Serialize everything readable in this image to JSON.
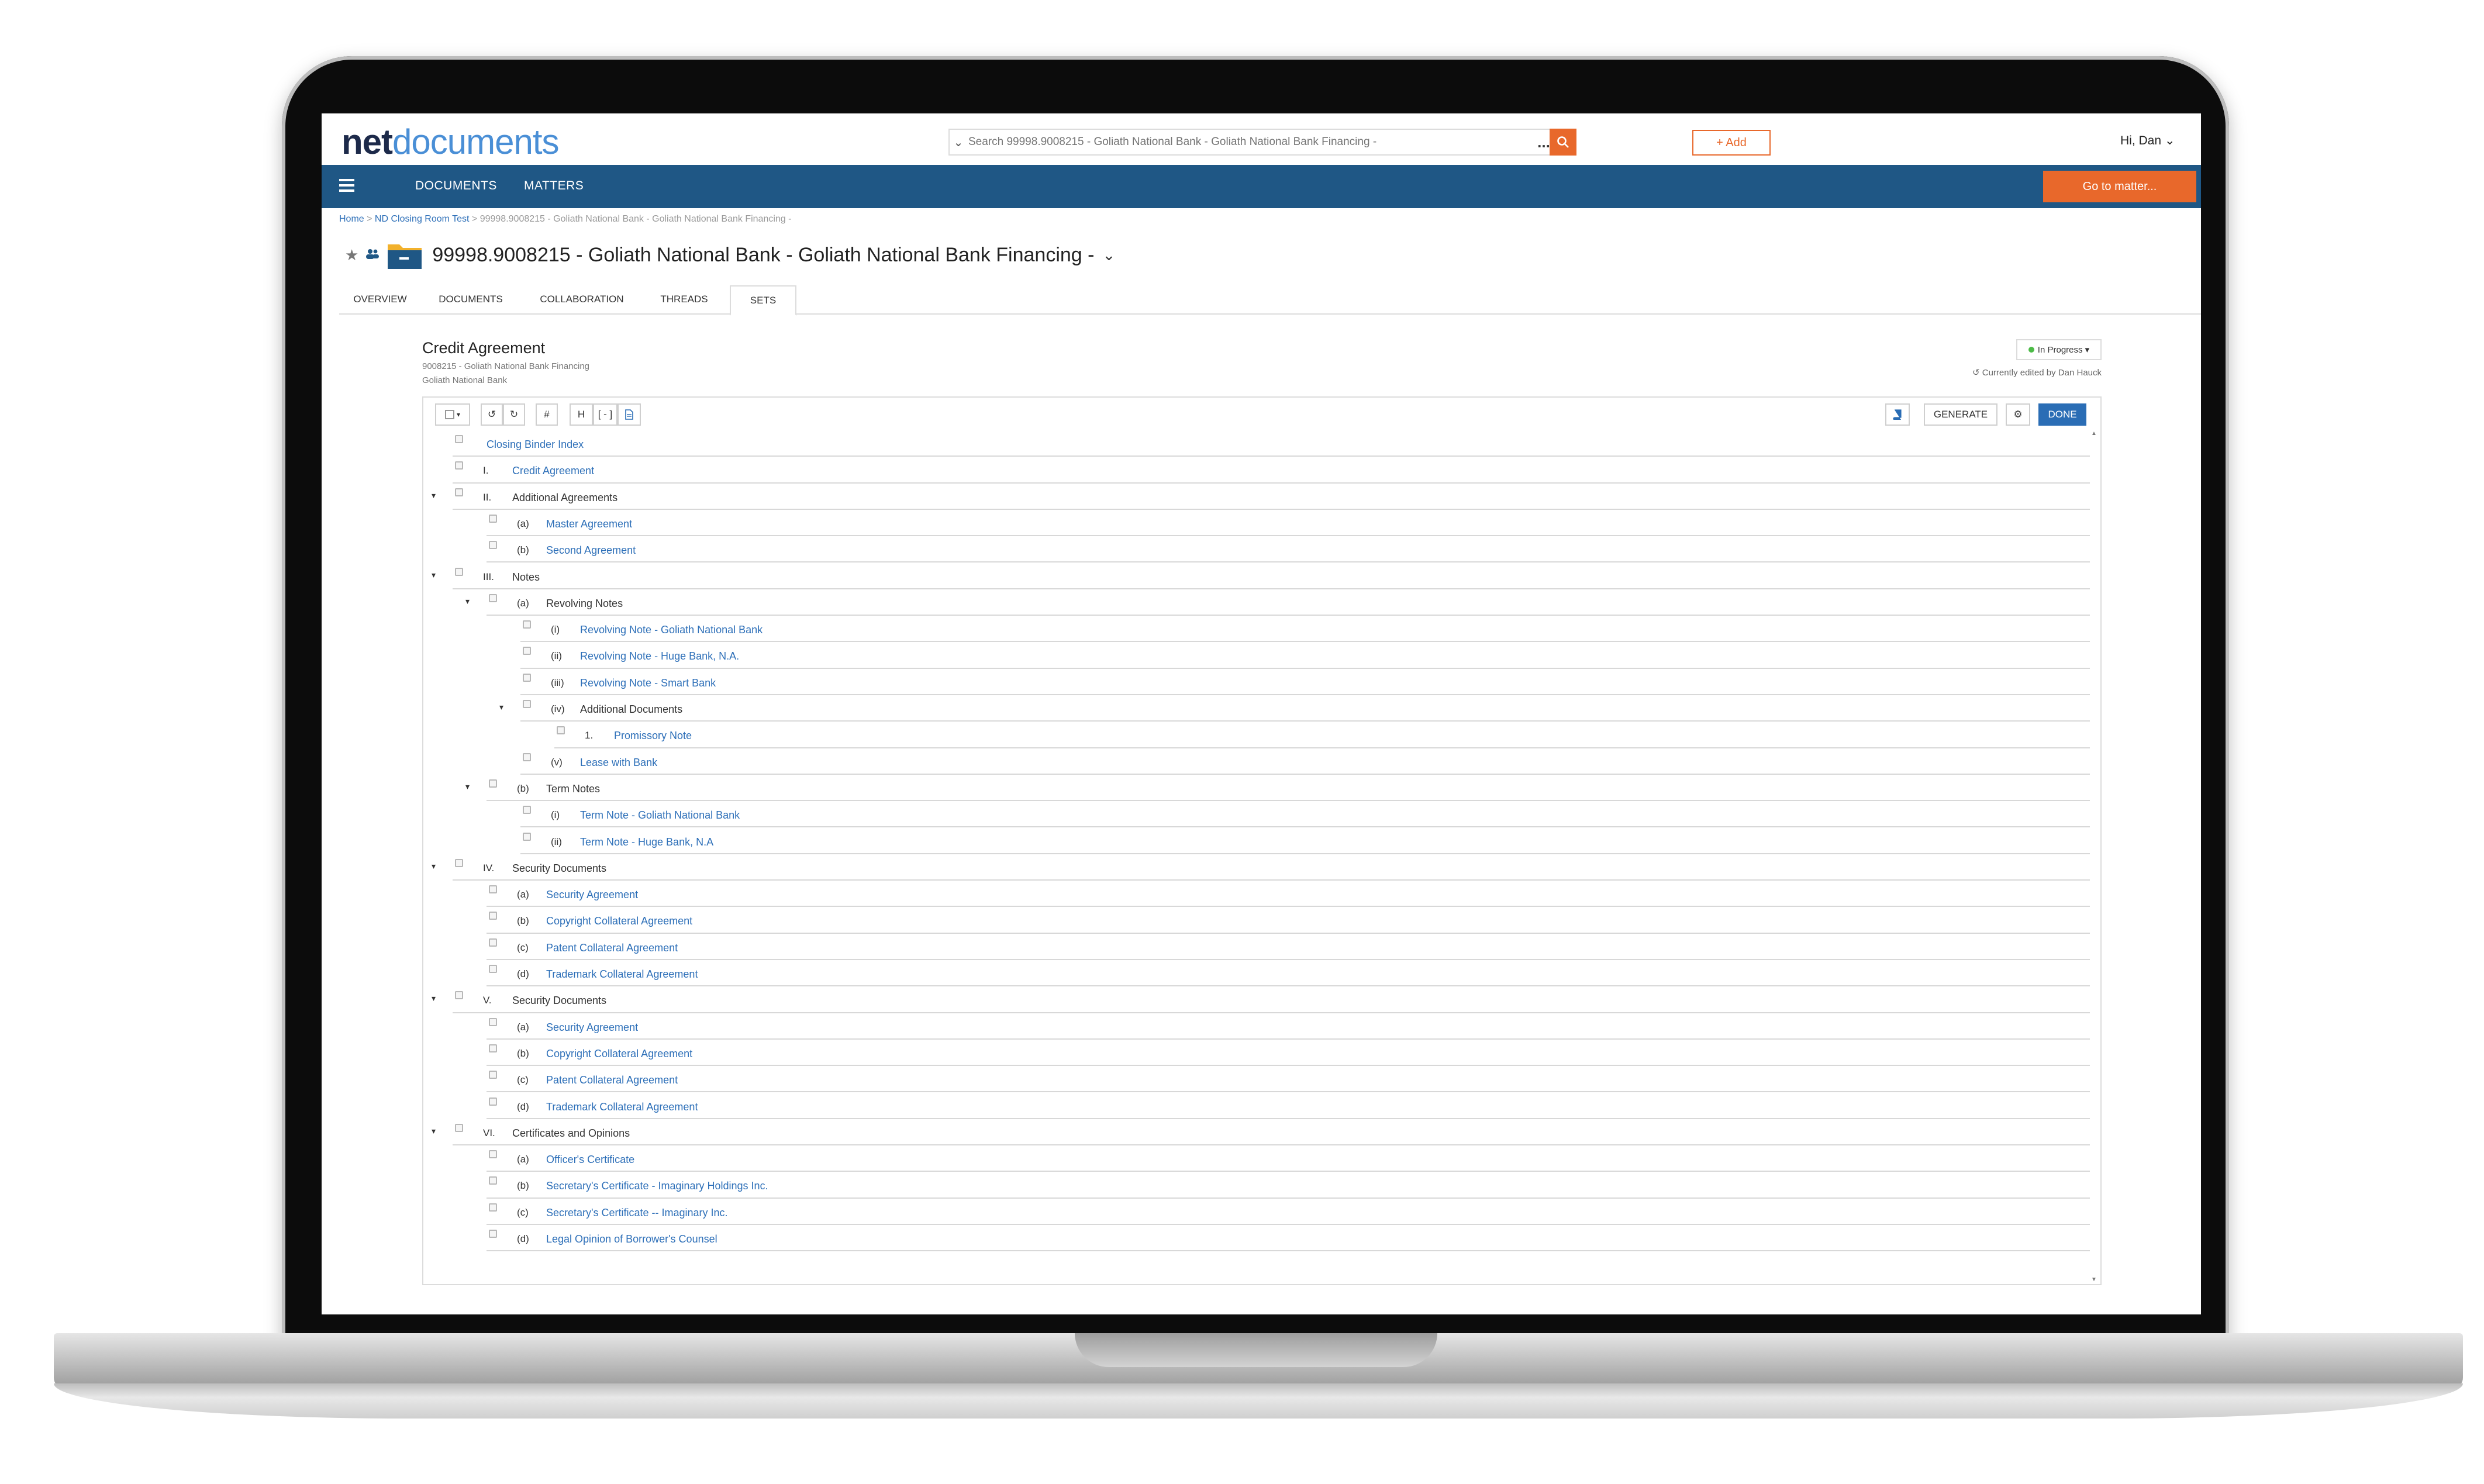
{
  "header": {
    "logo_net": "net",
    "logo_docs": "documents",
    "search_placeholder": "Search 99998.9008215 - Goliath National Bank - Goliath National Bank Financing -",
    "search_more": "...",
    "add_label": "+ Add",
    "user_greeting": "Hi,  Dan",
    "user_chevron": "⌄"
  },
  "nav": {
    "items": [
      "DOCUMENTS",
      "MATTERS"
    ],
    "goto_label": "Go to matter..."
  },
  "breadcrumb": {
    "home": "Home",
    "sep1": " > ",
    "room": "ND Closing Room Test",
    "sep2": " > ",
    "current": "99998.9008215 - Goliath National Bank - Goliath National Bank Financing -"
  },
  "title": {
    "star": "★",
    "people": "👥",
    "text": "99998.9008215 - Goliath National Bank - Goliath National Bank Financing -",
    "chevron": "⌄"
  },
  "tabs": [
    "OVERVIEW",
    "DOCUMENTS",
    "COLLABORATION",
    "THREADS",
    "SETS"
  ],
  "active_tab": "SETS",
  "document": {
    "title": "Credit Agreement",
    "subtitle1": "9008215 - Goliath National Bank Financing",
    "subtitle2": "Goliath National Bank",
    "status": "In Progress ▾",
    "edited_by": "Currently edited by Dan Hauck"
  },
  "toolbar": {
    "undo_icon": "↺",
    "redo_icon": "↻",
    "hash": "#",
    "heading": "H",
    "bracket": "[ - ]",
    "generate": "GENERATE",
    "done": "DONE",
    "gear_icon": "⚙"
  },
  "rows": [
    {
      "level": 0,
      "num": "",
      "label": "Closing Binder Index",
      "link": true,
      "caret": false
    },
    {
      "level": 0,
      "num": "I.",
      "label": "Credit Agreement",
      "link": true,
      "caret": false
    },
    {
      "level": 0,
      "num": "II.",
      "label": "Additional Agreements",
      "link": false,
      "caret": true
    },
    {
      "level": 1,
      "num": "(a)",
      "label": "Master Agreement",
      "link": true,
      "caret": false
    },
    {
      "level": 1,
      "num": "(b)",
      "label": "Second Agreement",
      "link": true,
      "caret": false
    },
    {
      "level": 0,
      "num": "III.",
      "label": "Notes",
      "link": false,
      "caret": true
    },
    {
      "level": 1,
      "num": "(a)",
      "label": "Revolving Notes",
      "link": false,
      "caret": true
    },
    {
      "level": 2,
      "num": "(i)",
      "label": "Revolving Note - Goliath National Bank",
      "link": true,
      "caret": false
    },
    {
      "level": 2,
      "num": "(ii)",
      "label": "Revolving Note - Huge Bank, N.A.",
      "link": true,
      "caret": false
    },
    {
      "level": 2,
      "num": "(iii)",
      "label": "Revolving Note - Smart Bank",
      "link": true,
      "caret": false
    },
    {
      "level": 2,
      "num": "(iv)",
      "label": "Additional Documents",
      "link": false,
      "caret": true
    },
    {
      "level": 3,
      "num": "1.",
      "label": "Promissory Note",
      "link": true,
      "caret": false
    },
    {
      "level": 2,
      "num": "(v)",
      "label": "Lease with Bank",
      "link": true,
      "caret": false
    },
    {
      "level": 1,
      "num": "(b)",
      "label": "Term Notes",
      "link": false,
      "caret": true
    },
    {
      "level": 2,
      "num": "(i)",
      "label": "Term Note - Goliath National Bank",
      "link": true,
      "caret": false
    },
    {
      "level": 2,
      "num": "(ii)",
      "label": "Term Note - Huge Bank, N.A",
      "link": true,
      "caret": false
    },
    {
      "level": 0,
      "num": "IV.",
      "label": "Security Documents",
      "link": false,
      "caret": true
    },
    {
      "level": 1,
      "num": "(a)",
      "label": "Security Agreement",
      "link": true,
      "caret": false
    },
    {
      "level": 1,
      "num": "(b)",
      "label": "Copyright Collateral Agreement",
      "link": true,
      "caret": false
    },
    {
      "level": 1,
      "num": "(c)",
      "label": "Patent Collateral Agreement",
      "link": true,
      "caret": false
    },
    {
      "level": 1,
      "num": "(d)",
      "label": "Trademark Collateral Agreement",
      "link": true,
      "caret": false
    },
    {
      "level": 0,
      "num": "V.",
      "label": "Security Documents",
      "link": false,
      "caret": true
    },
    {
      "level": 1,
      "num": "(a)",
      "label": "Security Agreement",
      "link": true,
      "caret": false
    },
    {
      "level": 1,
      "num": "(b)",
      "label": "Copyright Collateral Agreement",
      "link": true,
      "caret": false
    },
    {
      "level": 1,
      "num": "(c)",
      "label": "Patent Collateral Agreement",
      "link": true,
      "caret": false
    },
    {
      "level": 1,
      "num": "(d)",
      "label": "Trademark Collateral Agreement",
      "link": true,
      "caret": false
    },
    {
      "level": 0,
      "num": "VI.",
      "label": "Certificates and Opinions",
      "link": false,
      "caret": true
    },
    {
      "level": 1,
      "num": "(a)",
      "label": "Officer's Certificate",
      "link": true,
      "caret": false
    },
    {
      "level": 1,
      "num": "(b)",
      "label": "Secretary's Certificate - Imaginary Holdings Inc.",
      "link": true,
      "caret": false
    },
    {
      "level": 1,
      "num": "(c)",
      "label": "Secretary's Certificate -- Imaginary Inc.",
      "link": true,
      "caret": false
    },
    {
      "level": 1,
      "num": "(d)",
      "label": "Legal Opinion of Borrower's Counsel",
      "link": true,
      "caret": false
    }
  ],
  "colors": {
    "nav_bg": "#1f5785",
    "accent_orange": "#e8682b",
    "link_blue": "#2d6fb8",
    "done_blue": "#2a6db5",
    "status_green": "#4cbb47"
  }
}
